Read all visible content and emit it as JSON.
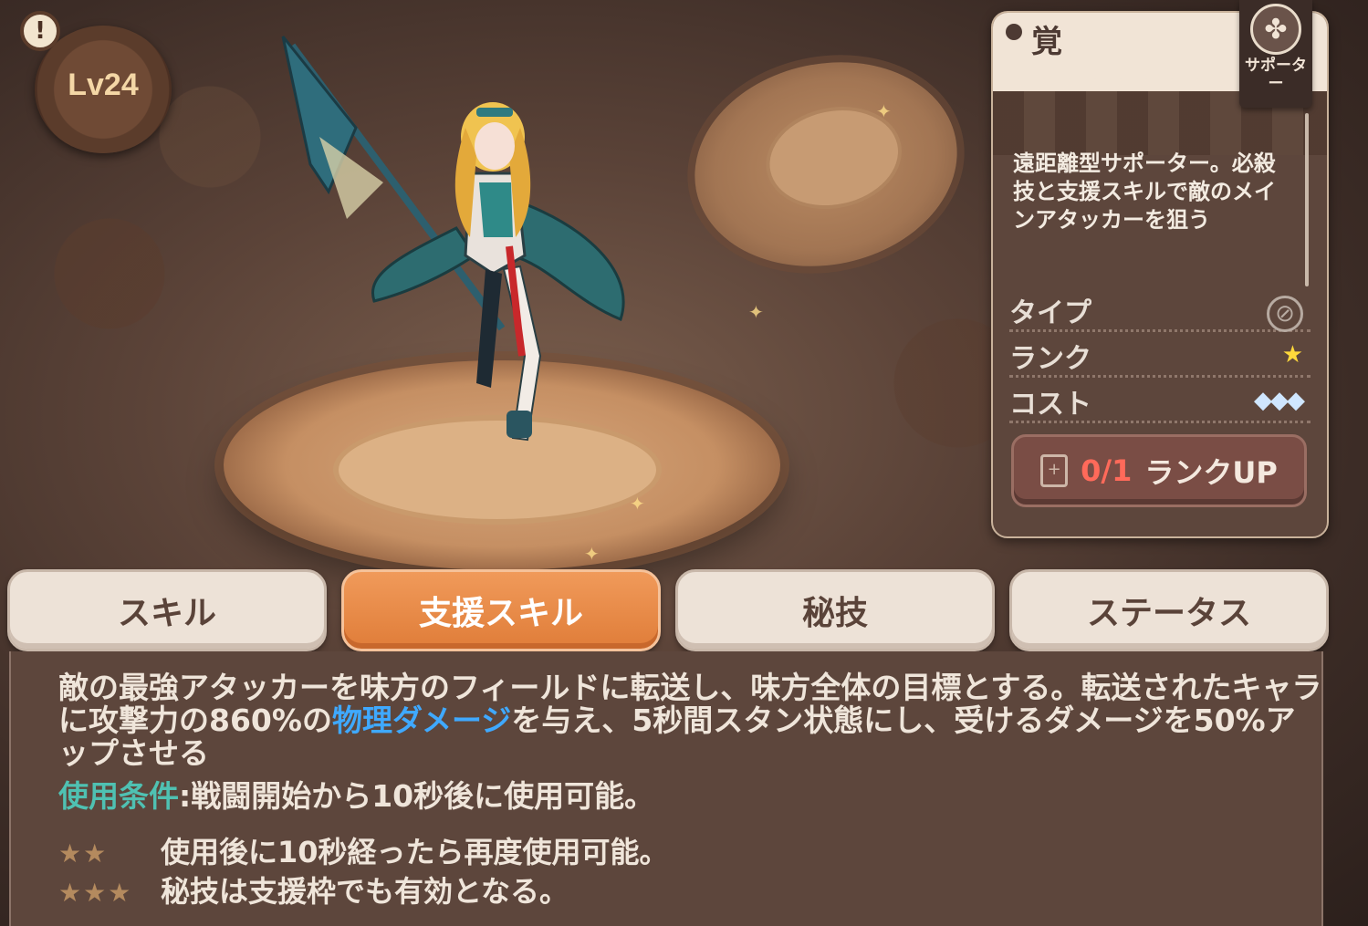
{
  "level": {
    "text": "Lv24",
    "alert": "!"
  },
  "info_panel": {
    "awaken_label": "覚",
    "role": {
      "icon": "support-icon",
      "label": "サポーター"
    },
    "description": "遠距離型サポーター。必殺技と支援スキルで敵のメインアタッカーを狙う",
    "attributes": [
      {
        "label": "タイプ",
        "icon": "physical-type-icon"
      },
      {
        "label": "ランク",
        "icon": "star-icon"
      },
      {
        "label": "コスト",
        "icon": "gem-icon"
      }
    ],
    "rank_up": {
      "count": "0/1",
      "label": "ランクUP"
    }
  },
  "tabs": [
    {
      "label": "スキル",
      "active": false
    },
    {
      "label": "支援スキル",
      "active": true
    },
    {
      "label": "秘技",
      "active": false
    },
    {
      "label": "ステータス",
      "active": false
    }
  ],
  "skill": {
    "text_before": "敵の最強アタッカーを味方のフィールドに転送し、味方全体の目標とする。転送されたキャラに攻撃力の860%の",
    "highlight": "物理ダメージ",
    "text_after": "を与え、5秒間スタン状態にし、受けるダメージを50%アップさせる",
    "condition_label": "使用条件",
    "condition_text": ":戦闘開始から10秒後に使用可能。",
    "rank_effects": [
      {
        "stars": 2,
        "text": "使用後に10秒経ったら再度使用可能。"
      },
      {
        "stars": 3,
        "text": "秘技は支援枠でも有効となる。"
      }
    ]
  },
  "colors": {
    "active_tab": "#e88a45",
    "highlight_blue": "#3fa9ff",
    "condition_teal": "#4fc1b2",
    "rank_count_red": "#ff6a5a"
  }
}
